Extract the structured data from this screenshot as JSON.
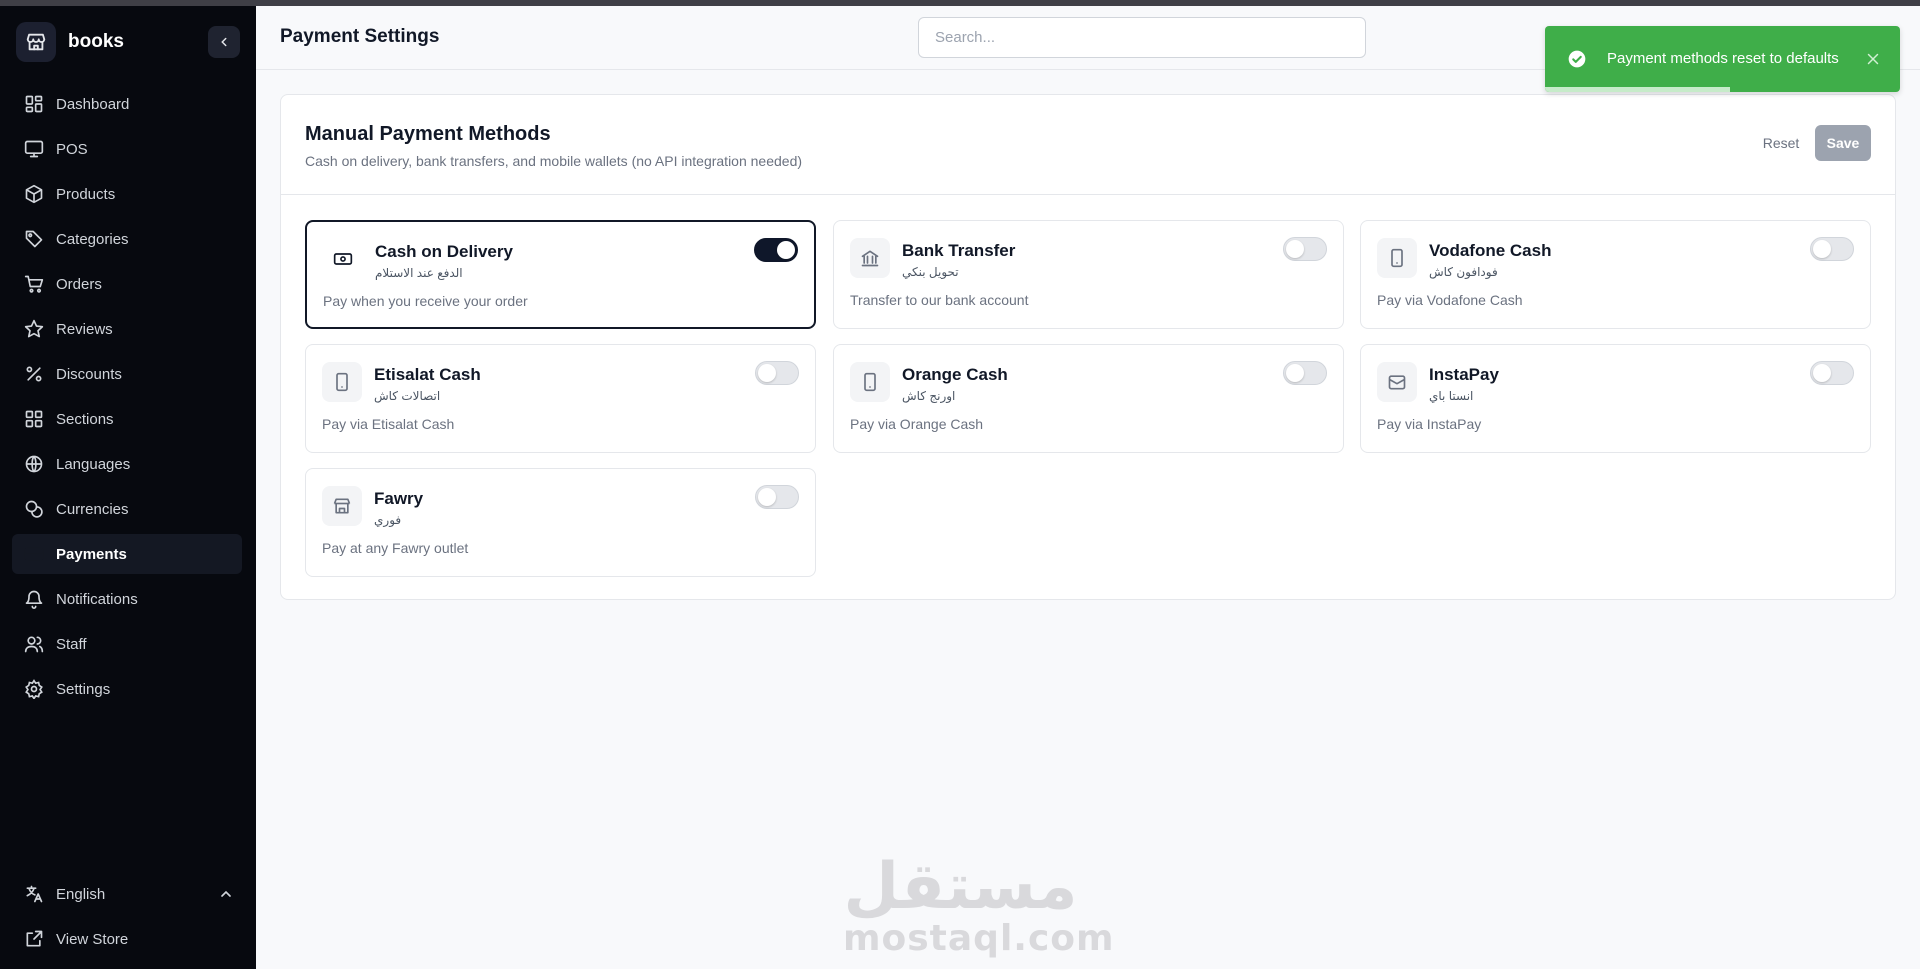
{
  "app": {
    "name": "books"
  },
  "header": {
    "title": "Payment Settings",
    "search_placeholder": "Search..."
  },
  "sidebar": {
    "items": [
      {
        "label": "Dashboard",
        "icon": "dashboard-icon"
      },
      {
        "label": "POS",
        "icon": "monitor-icon"
      },
      {
        "label": "Products",
        "icon": "package-icon"
      },
      {
        "label": "Categories",
        "icon": "tag-icon"
      },
      {
        "label": "Orders",
        "icon": "cart-icon"
      },
      {
        "label": "Reviews",
        "icon": "star-icon"
      },
      {
        "label": "Discounts",
        "icon": "percent-icon"
      },
      {
        "label": "Sections",
        "icon": "grid-icon"
      },
      {
        "label": "Languages",
        "icon": "globe-icon"
      },
      {
        "label": "Currencies",
        "icon": "coins-icon"
      },
      {
        "label": "Payments",
        "icon": "credit-card-icon",
        "active": true
      },
      {
        "label": "Notifications",
        "icon": "bell-icon"
      },
      {
        "label": "Staff",
        "icon": "users-icon"
      },
      {
        "label": "Settings",
        "icon": "gear-icon"
      }
    ],
    "footer": {
      "language": "English",
      "view_store": "View Store"
    }
  },
  "toast": {
    "message": "Payment methods reset to defaults",
    "color": "#3fae49",
    "progress": 0.52
  },
  "card": {
    "title": "Manual Payment Methods",
    "subtitle": "Cash on delivery, bank transfers, and mobile wallets (no API integration needed)",
    "reset_label": "Reset",
    "save_label": "Save"
  },
  "methods": [
    {
      "name": "Cash on Delivery",
      "name_ar": "الدفع عند الاستلام",
      "description": "Pay when you receive your order",
      "enabled": true,
      "icon": "banknote-icon"
    },
    {
      "name": "Bank Transfer",
      "name_ar": "تحويل بنكي",
      "description": "Transfer to our bank account",
      "enabled": false,
      "icon": "bank-icon"
    },
    {
      "name": "Vodafone Cash",
      "name_ar": "فودافون كاش",
      "description": "Pay via Vodafone Cash",
      "enabled": false,
      "icon": "smartphone-icon"
    },
    {
      "name": "Etisalat Cash",
      "name_ar": "اتصالات كاش",
      "description": "Pay via Etisalat Cash",
      "enabled": false,
      "icon": "smartphone-icon"
    },
    {
      "name": "Orange Cash",
      "name_ar": "اورنج كاش",
      "description": "Pay via Orange Cash",
      "enabled": false,
      "icon": "smartphone-icon"
    },
    {
      "name": "InstaPay",
      "name_ar": "انستا باي",
      "description": "Pay via InstaPay",
      "enabled": false,
      "icon": "wallet-icon"
    },
    {
      "name": "Fawry",
      "name_ar": "فوري",
      "description": "Pay at any Fawry outlet",
      "enabled": false,
      "icon": "store-icon"
    }
  ],
  "watermark": {
    "arabic": "مستقل",
    "latin": "mostaql.com"
  }
}
